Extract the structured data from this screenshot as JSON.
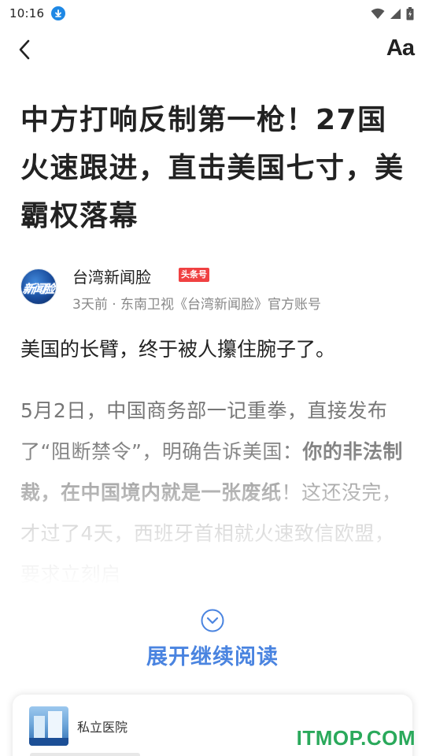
{
  "status_bar": {
    "time": "10:16",
    "icons": [
      "download-notification-icon",
      "wifi-icon",
      "signal-icon",
      "battery-icon"
    ]
  },
  "nav": {
    "back_icon": "back-arrow-icon",
    "font_size_label": "Aa"
  },
  "article": {
    "title": "中方打响反制第一枪！27国火速跟进，直击美国七寸，美霸权落幕",
    "author": {
      "name": "台湾新闻脸",
      "badge": "头条号",
      "meta": "3天前 · 东南卫视《台湾新闻脸》官方账号",
      "avatar_text": "新闻脸"
    },
    "lead": "美国的长臂，终于被人攥住腕子了。",
    "paragraph_normal_1": "5月2日，中国商务部一记重拳，直接发布了“阻断禁令”，明确告诉美国：",
    "paragraph_bold": "你的非法制裁，在中国境内就是一张废纸",
    "paragraph_normal_2": "！这还没完，才过了4天，西班牙首相就火速致信欧盟，要求立刻启"
  },
  "expand": {
    "icon": "chevron-down-circle-icon",
    "label": "展开继续阅读"
  },
  "recommendation": {
    "title": "私立医院"
  },
  "watermark": "ITMOP.COM",
  "colors": {
    "accent_blue": "#4a84e0",
    "badge_red": "#f04142",
    "download_blue": "#1e88e5",
    "watermark_green": "#2aa95b"
  }
}
